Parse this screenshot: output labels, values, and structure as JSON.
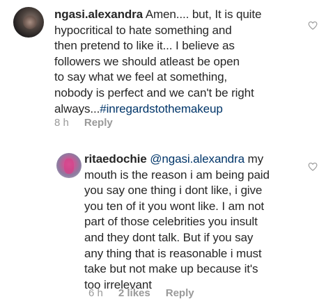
{
  "comments": [
    {
      "username": "ngasi.alexandra",
      "text_lines": [
        "Amen.... but, It is quite",
        "hypocritical to hate something and",
        "then pretend to like it... I believe as",
        "followers we should atleast  be open",
        "to say what we feel at something,",
        "nobody is perfect and we can't be right",
        "always..."
      ],
      "hashtag": "#inregardstothemakeup",
      "time": "8 h",
      "reply_label": "Reply",
      "like_icon": "heart-outline-icon"
    },
    {
      "username": "ritaedochie",
      "mention": "@ngasi.alexandra",
      "text_after_mention": " my",
      "text_lines": [
        "mouth is the reason i am being paid",
        "you say one thing i dont like, i give",
        "you ten of it you wont like. I am not",
        "part of those celebrities you insult",
        "and they dont talk. But if you say",
        "any thing that is reasonable i must",
        "take but  not make up because it's",
        "too irrelevant"
      ],
      "time": "6 h",
      "likes": "2 likes",
      "reply_label": "Reply",
      "like_icon": "heart-outline-icon"
    }
  ],
  "colors": {
    "text": "#262626",
    "link": "#003569",
    "meta": "#999999"
  }
}
